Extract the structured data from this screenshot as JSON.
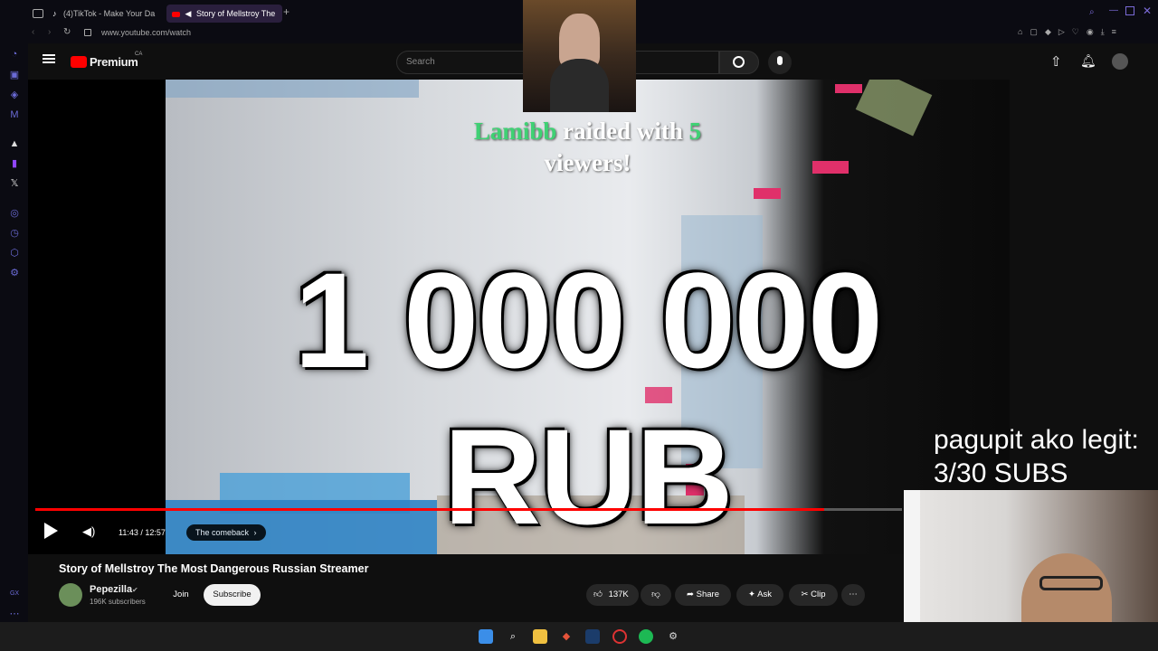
{
  "browser": {
    "tabs": [
      {
        "label": "(4)TikTok - Make Your Da",
        "active": false
      },
      {
        "label": "Story of Mellstroy The",
        "active": true
      }
    ],
    "url": "www.youtube.com/watch"
  },
  "youtube": {
    "logo": "Premium",
    "logo_region": "CA",
    "search_placeholder": "Search"
  },
  "video": {
    "raid_user": "Lamibb",
    "raid_text_1": "raided with",
    "raid_count": "5",
    "raid_text_2": "viewers!",
    "big_text": "1 000 000 RUB",
    "time": "11:43 / 12:57",
    "chapter": "The comeback",
    "progress": 0.91
  },
  "overlay": {
    "line1": "pagupit ako legit:",
    "line2": "3/30 SUBS"
  },
  "meta": {
    "title": "Story of Mellstroy The Most Dangerous Russian Streamer",
    "channel": "Pepezilla",
    "subscribers": "196K subscribers",
    "join": "Join",
    "subscribe": "Subscribe",
    "likes": "137K",
    "share": "Share",
    "ask": "Ask",
    "clip": "Clip"
  },
  "colors": {
    "accent_red": "#ff0000",
    "raid_green": "#3fd174",
    "opera_purple": "#6b6bd6"
  }
}
